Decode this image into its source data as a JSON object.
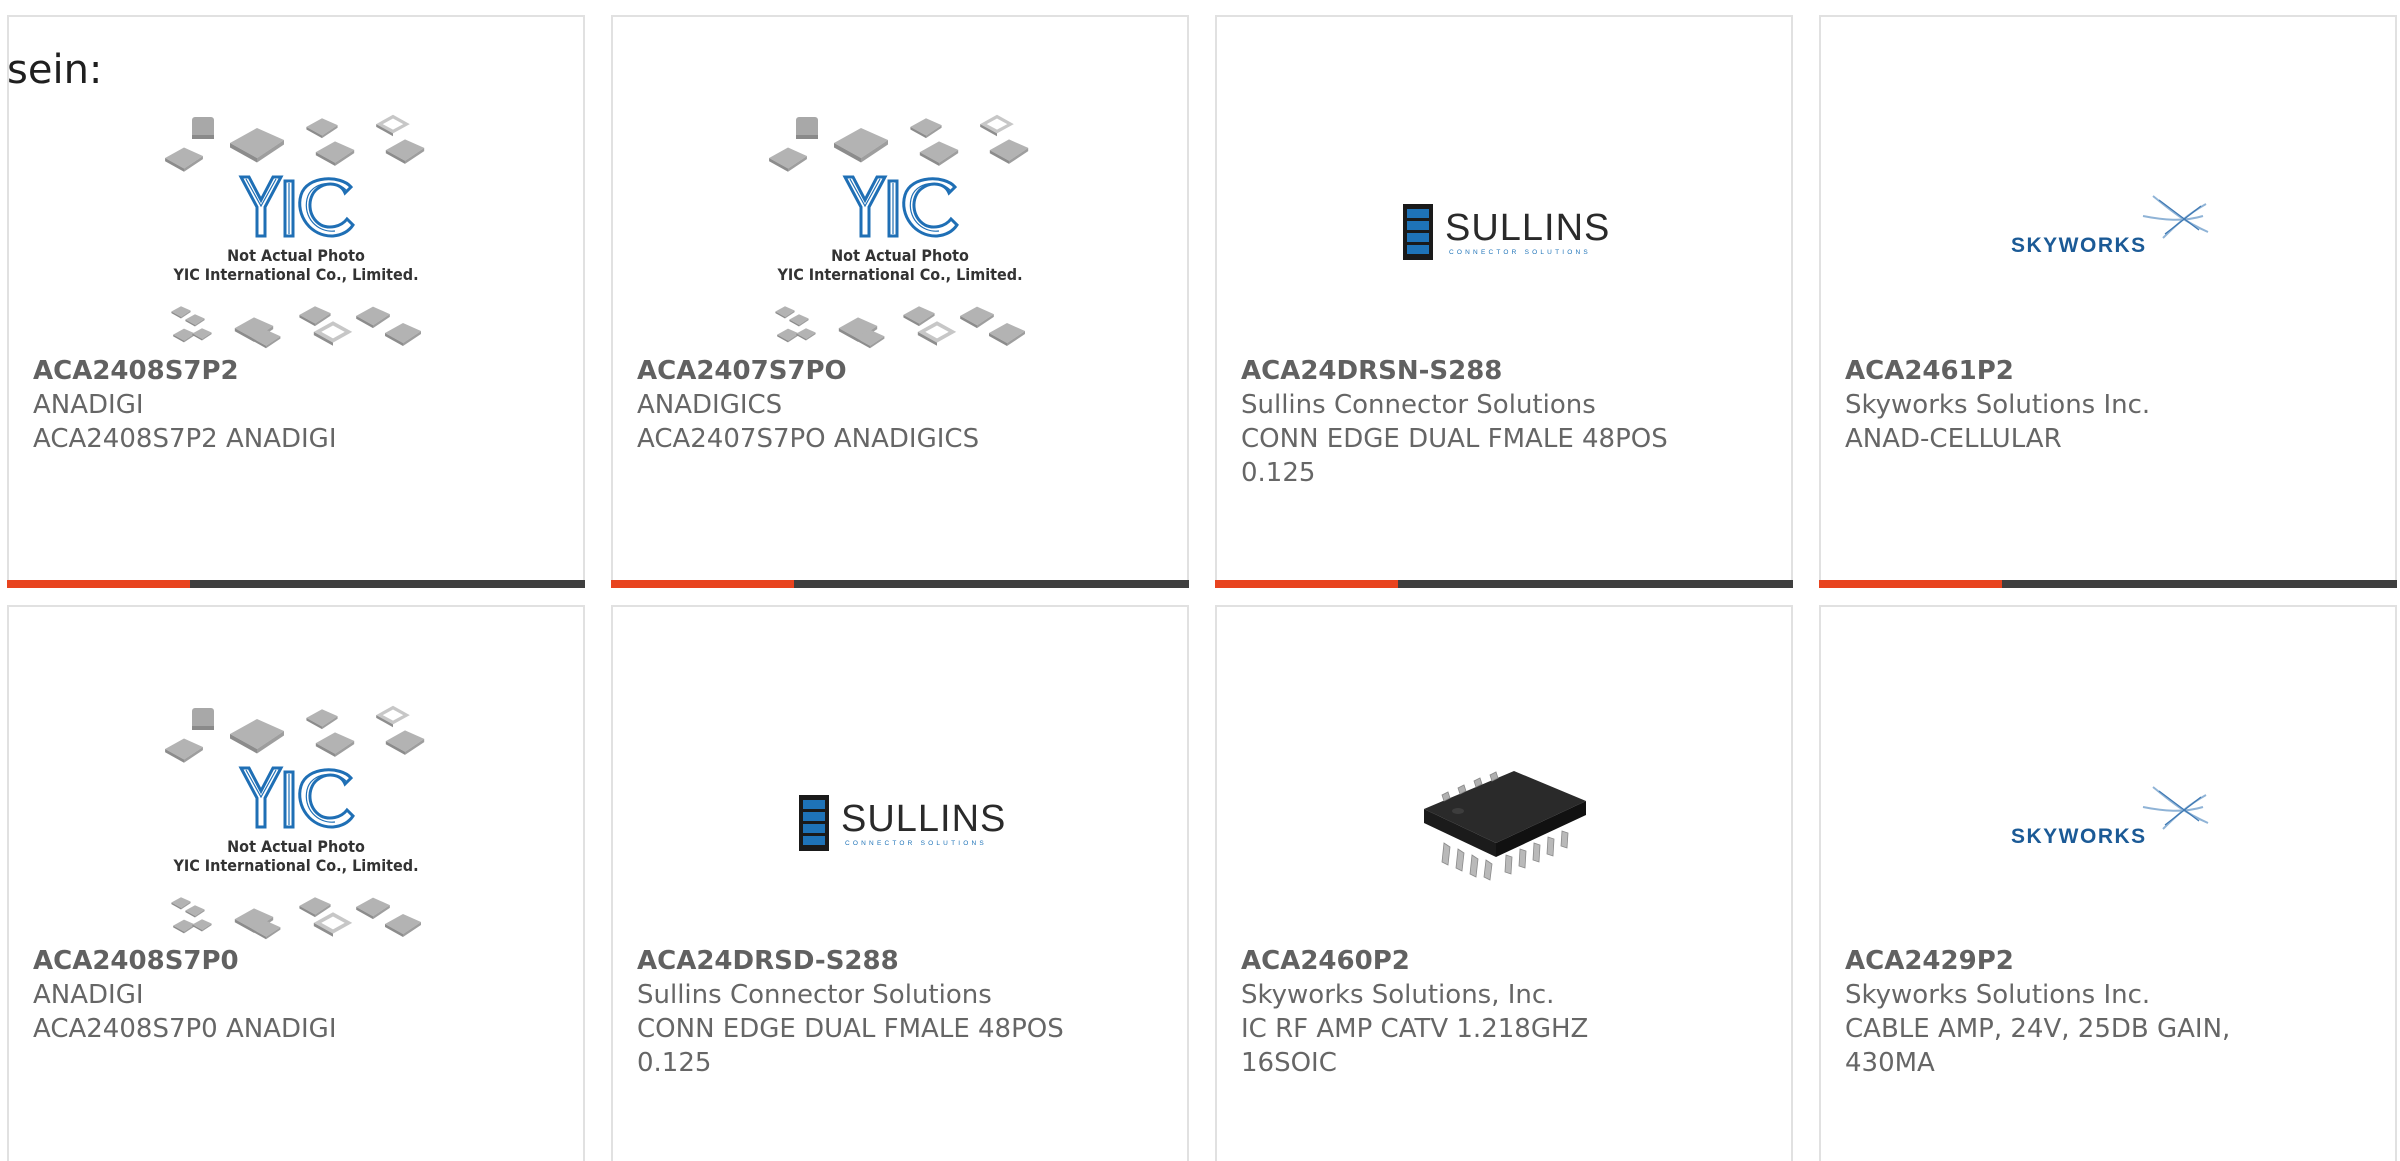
{
  "leading_text": "sein:",
  "colors": {
    "accent": "#e8441f",
    "bar": "#3f3f3f",
    "text": "#666666",
    "yic_blue": "#1f6fb5",
    "sullins_blue": "#1e73b8",
    "skyworks_blue": "#1b5a96"
  },
  "yic_logo": {
    "brand": "YIC",
    "caption_line1": "Not Actual Photo",
    "caption_line2": "YIC International Co., Limited."
  },
  "sullins_logo": {
    "brand": "SULLINS",
    "tagline": "CONNECTOR SOLUTIONS"
  },
  "skyworks_logo": {
    "brand": "SKYWORKS"
  },
  "products": [
    {
      "image": "yic-placeholder",
      "part_number": "ACA2408S7P2",
      "manufacturer": "ANADIGI",
      "desc_line1": "ACA2408S7P2 ANADIGI",
      "desc_line2": ""
    },
    {
      "image": "yic-placeholder",
      "part_number": "ACA2407S7PO",
      "manufacturer": "ANADIGICS",
      "desc_line1": "ACA2407S7PO ANADIGICS",
      "desc_line2": ""
    },
    {
      "image": "sullins-logo",
      "part_number": "ACA24DRSN-S288",
      "manufacturer": "Sullins Connector Solutions",
      "desc_line1": "CONN EDGE DUAL FMALE 48POS",
      "desc_line2": "0.125"
    },
    {
      "image": "skyworks-logo",
      "part_number": "ACA2461P2",
      "manufacturer": "Skyworks Solutions Inc.",
      "desc_line1": "ANAD-CELLULAR",
      "desc_line2": ""
    },
    {
      "image": "yic-placeholder",
      "part_number": "ACA2408S7P0",
      "manufacturer": "ANADIGI",
      "desc_line1": "ACA2408S7P0 ANADIGI",
      "desc_line2": ""
    },
    {
      "image": "sullins-logo",
      "part_number": "ACA24DRSD-S288",
      "manufacturer": "Sullins Connector Solutions",
      "desc_line1": "CONN EDGE DUAL FMALE 48POS",
      "desc_line2": "0.125"
    },
    {
      "image": "soic-chip-photo",
      "part_number": "ACA2460P2",
      "manufacturer": "Skyworks Solutions, Inc.",
      "desc_line1": "IC RF AMP CATV 1.218GHZ",
      "desc_line2": "16SOIC"
    },
    {
      "image": "skyworks-logo",
      "part_number": "ACA2429P2",
      "manufacturer": "Skyworks Solutions Inc.",
      "desc_line1": "CABLE AMP, 24V, 25DB GAIN,",
      "desc_line2": "430MA"
    }
  ]
}
